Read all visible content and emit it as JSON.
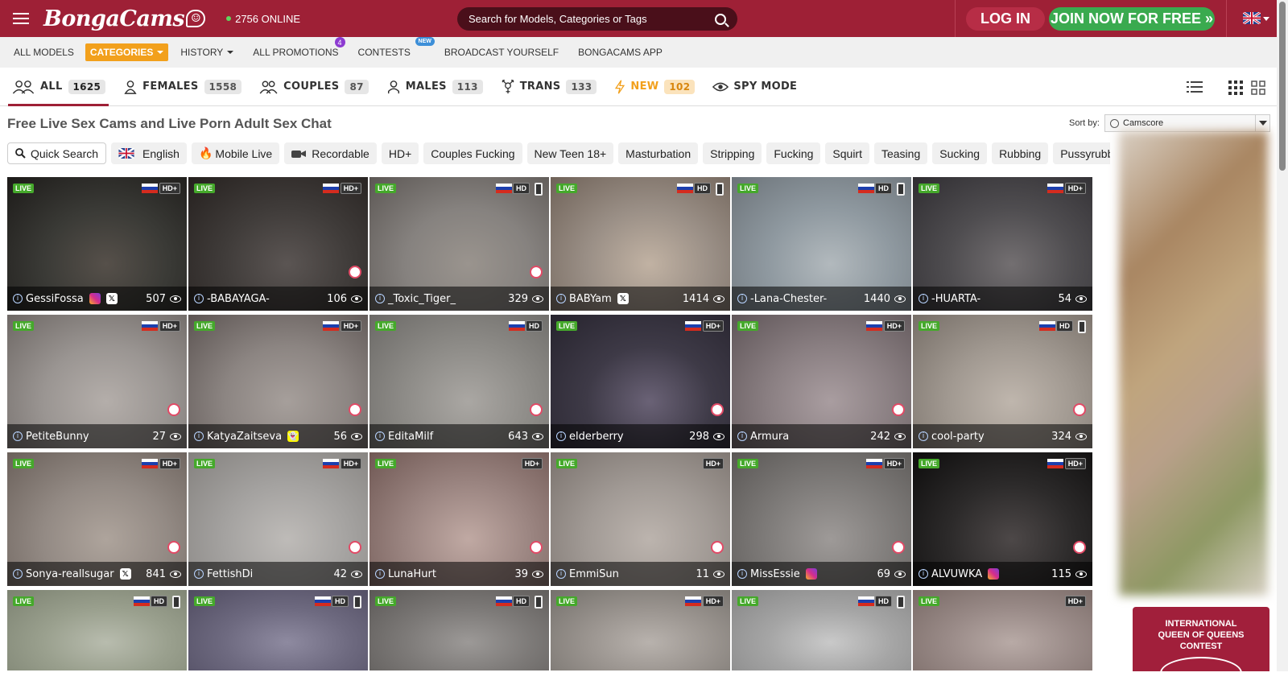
{
  "header": {
    "logo": "BongaCams",
    "online": "2756 ONLINE",
    "search_placeholder": "Search for Models, Categories or Tags",
    "login": "LOG IN",
    "join": "JOIN NOW FOR FREE »"
  },
  "nav": {
    "all_models": "ALL MODELS",
    "categories": "CATEGORIES",
    "history": "HISTORY",
    "promotions": "ALL PROMOTIONS",
    "promotions_badge": "4",
    "contests": "CONTESTS",
    "contests_badge": "NEW",
    "broadcast": "BROADCAST YOURSELF",
    "app": "BONGACAMS APP"
  },
  "tabs": [
    {
      "label": "ALL",
      "count": "1625"
    },
    {
      "label": "FEMALES",
      "count": "1558"
    },
    {
      "label": "COUPLES",
      "count": "87"
    },
    {
      "label": "MALES",
      "count": "113"
    },
    {
      "label": "TRANS",
      "count": "133"
    },
    {
      "label": "NEW",
      "count": "102"
    },
    {
      "label": "SPY MODE",
      "count": ""
    }
  ],
  "page_title": "Free Live Sex Cams and Live Porn Adult Sex Chat",
  "sort": {
    "label": "Sort by:",
    "value": "Camscore"
  },
  "chips": [
    "Quick Search",
    "English",
    "Mobile Live",
    "Recordable",
    "HD+",
    "Couples Fucking",
    "New Teen 18+",
    "Masturbation",
    "Stripping",
    "Fucking",
    "Squirt",
    "Teasing",
    "Sucking",
    "Rubbing",
    "Pussyrubbing",
    "+"
  ],
  "live_label": "LIVE",
  "models": [
    {
      "name": "GessiFossa",
      "viewers": "507",
      "quality": "HD+",
      "flag": true,
      "phone": false,
      "sticker": false,
      "social": [
        "ig",
        "x"
      ],
      "bg": [
        "#3a3a36",
        "#1c1a18",
        "#56504a"
      ]
    },
    {
      "name": "-BABAYAGA-",
      "viewers": "106",
      "quality": "HD+",
      "flag": true,
      "phone": false,
      "sticker": true,
      "social": [],
      "bg": [
        "#403c3a",
        "#25201e",
        "#5b5553"
      ]
    },
    {
      "name": "_Toxic_Tiger_",
      "viewers": "329",
      "quality": "HD",
      "flag": true,
      "phone": true,
      "sticker": true,
      "social": [],
      "bg": [
        "#86827f",
        "#5c5754",
        "#9a948e"
      ]
    },
    {
      "name": "BABYam",
      "viewers": "1414",
      "quality": "HD",
      "flag": true,
      "phone": true,
      "sticker": false,
      "social": [
        "x"
      ],
      "bg": [
        "#9a8f86",
        "#6f6258",
        "#c1b2a3"
      ]
    },
    {
      "name": "-Lana-Chester-",
      "viewers": "1440",
      "quality": "HD",
      "flag": true,
      "phone": true,
      "sticker": false,
      "social": [],
      "bg": [
        "#8f99a0",
        "#6c7379",
        "#b2b9bd"
      ]
    },
    {
      "name": "-HUARTA-",
      "viewers": "54",
      "quality": "HD+",
      "flag": true,
      "phone": false,
      "sticker": false,
      "social": [],
      "bg": [
        "#4f4d50",
        "#2f2d31",
        "#736f71"
      ]
    },
    {
      "name": "PetiteBunny",
      "viewers": "27",
      "quality": "HD+",
      "flag": true,
      "phone": false,
      "sticker": true,
      "social": [],
      "bg": [
        "#9a9592",
        "#6d6764",
        "#b4aeaa"
      ]
    },
    {
      "name": "KatyaZaitseva",
      "viewers": "56",
      "quality": "HD+",
      "flag": true,
      "phone": false,
      "sticker": true,
      "social": [
        "sc"
      ],
      "bg": [
        "#8c8582",
        "#5c5452",
        "#a69f9b"
      ]
    },
    {
      "name": "EditaMilf",
      "viewers": "643",
      "quality": "HD",
      "flag": true,
      "phone": false,
      "sticker": true,
      "social": [],
      "bg": [
        "#8e8c88",
        "#6b6966",
        "#aaa7a3"
      ]
    },
    {
      "name": "elderberry",
      "viewers": "298",
      "quality": "HD+",
      "flag": true,
      "phone": false,
      "sticker": true,
      "social": [],
      "bg": [
        "#3e3a47",
        "#26232d",
        "#6a6276"
      ]
    },
    {
      "name": "Armura",
      "viewers": "242",
      "quality": "HD+",
      "flag": true,
      "phone": false,
      "sticker": true,
      "social": [],
      "bg": [
        "#8a7f82",
        "#5f5558",
        "#a99da0"
      ]
    },
    {
      "name": "cool-party",
      "viewers": "324",
      "quality": "HD",
      "flag": true,
      "phone": true,
      "sticker": true,
      "social": [],
      "bg": [
        "#a19991",
        "#766e67",
        "#bfb6ad"
      ]
    },
    {
      "name": "Sonya-reallsugar",
      "viewers": "841",
      "quality": "HD+",
      "flag": true,
      "phone": false,
      "sticker": true,
      "social": [
        "x"
      ],
      "bg": [
        "#938a84",
        "#6a605a",
        "#aea49c"
      ]
    },
    {
      "name": "FettishDi",
      "viewers": "42",
      "quality": "HD+",
      "flag": true,
      "phone": false,
      "sticker": true,
      "social": [],
      "bg": [
        "#a4a2a0",
        "#84817e",
        "#bebbb8"
      ]
    },
    {
      "name": "LunaHurt",
      "viewers": "39",
      "quality": "HD+",
      "flag": false,
      "phone": false,
      "sticker": true,
      "social": [],
      "bg": [
        "#9b8581",
        "#6f5753",
        "#c0a9a3"
      ]
    },
    {
      "name": "EmmiSun",
      "viewers": "11",
      "quality": "HD+",
      "flag": false,
      "phone": false,
      "sticker": true,
      "social": [],
      "bg": [
        "#a19a95",
        "#7a726d",
        "#bcb4ae"
      ]
    },
    {
      "name": "MissEssie",
      "viewers": "69",
      "quality": "HD+",
      "flag": true,
      "phone": false,
      "sticker": true,
      "social": [
        "ig"
      ],
      "bg": [
        "#7f7c7a",
        "#5a5755",
        "#9e9a98"
      ]
    },
    {
      "name": "ALVUWKA",
      "viewers": "115",
      "quality": "HD+",
      "flag": true,
      "phone": false,
      "sticker": true,
      "social": [
        "ig"
      ],
      "bg": [
        "#2c2a2a",
        "#0d0c0c",
        "#4d4848"
      ]
    },
    {
      "name": "",
      "viewers": "",
      "quality": "HD",
      "flag": true,
      "phone": true,
      "sticker": false,
      "social": [],
      "bg": [
        "#9aa08e",
        "#7b8170",
        "#b8bcae"
      ]
    },
    {
      "name": "",
      "viewers": "",
      "quality": "HD",
      "flag": true,
      "phone": true,
      "sticker": false,
      "social": [],
      "bg": [
        "#6e6a80",
        "#4f4b60",
        "#8e8aa0"
      ]
    },
    {
      "name": "",
      "viewers": "",
      "quality": "HD",
      "flag": true,
      "phone": true,
      "sticker": false,
      "social": [],
      "bg": [
        "#7d7a78",
        "#5b5856",
        "#9c9997"
      ]
    },
    {
      "name": "",
      "viewers": "",
      "quality": "HD+",
      "flag": true,
      "phone": false,
      "sticker": false,
      "social": [],
      "bg": [
        "#9a948f",
        "#74706b",
        "#b8b2ad"
      ]
    },
    {
      "name": "",
      "viewers": "",
      "quality": "HD",
      "flag": true,
      "phone": true,
      "sticker": false,
      "social": [],
      "bg": [
        "#a5a5a5",
        "#858585",
        "#c9c9c9"
      ]
    },
    {
      "name": "",
      "viewers": "",
      "quality": "HD+",
      "flag": false,
      "phone": false,
      "sticker": false,
      "social": [],
      "bg": [
        "#9a8b88",
        "#786965",
        "#b8aaa6"
      ]
    }
  ],
  "contest": {
    "line1": "INTERNATIONAL",
    "line2": "QUEEN OF QUEENS",
    "line3": "CONTEST"
  },
  "colors": {
    "brand": "#9e2036",
    "join": "#3aaa4f",
    "accent": "#f2a01c"
  }
}
